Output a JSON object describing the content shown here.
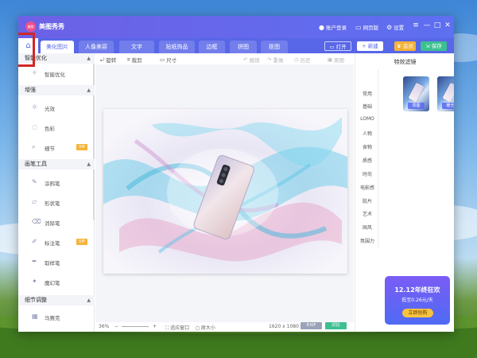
{
  "app": {
    "logo_text": "美图",
    "title": "美图秀秀"
  },
  "titlebar": {
    "account": "账户登录",
    "web_version": "网页版",
    "settings": "设置",
    "menu_symbol": "≡",
    "minimize_symbol": "—",
    "maximize_symbol": "□",
    "close_symbol": "✕"
  },
  "tabs": [
    {
      "label": "美化图片",
      "active": true
    },
    {
      "label": "人像美容",
      "active": false
    },
    {
      "label": "文字",
      "active": false
    },
    {
      "label": "贴纸饰品",
      "active": false
    },
    {
      "label": "边框",
      "active": false
    },
    {
      "label": "拼图",
      "active": false
    },
    {
      "label": "抠图",
      "active": false
    }
  ],
  "actions": {
    "open": "打开",
    "new": "+ 新建",
    "vip": "会员",
    "save": "保存"
  },
  "sidebar": {
    "sections": [
      {
        "title": "智能优化",
        "items": [
          {
            "label": "智能优化",
            "icon": "lightbulb-icon",
            "vip": false
          }
        ]
      },
      {
        "title": "增强",
        "items": [
          {
            "label": "光效",
            "icon": "sun-icon",
            "vip": false
          },
          {
            "label": "色彩",
            "icon": "palette-icon",
            "vip": false
          },
          {
            "label": "细节",
            "icon": "magnifier-icon",
            "vip": true
          }
        ]
      },
      {
        "title": "画笔工具",
        "items": [
          {
            "label": "涂鸦笔",
            "icon": "brush-icon",
            "vip": false
          },
          {
            "label": "形状笔",
            "icon": "shape-pen-icon",
            "vip": false
          },
          {
            "label": "消除笔",
            "icon": "eraser-icon",
            "vip": false
          },
          {
            "label": "标注笔",
            "icon": "marker-icon",
            "vip": true
          },
          {
            "label": "取样笔",
            "icon": "eyedropper-icon",
            "vip": false
          },
          {
            "label": "魔幻笔",
            "icon": "magic-pen-icon",
            "vip": false
          }
        ]
      },
      {
        "title": "细节调整",
        "items": [
          {
            "label": "马赛克",
            "icon": "mosaic-icon",
            "vip": false
          }
        ]
      }
    ],
    "vip_label": "VIP"
  },
  "toolbar": {
    "rotate": "旋转",
    "crop": "裁剪",
    "size": "尺寸",
    "undo": "撤销",
    "redo": "重做",
    "history": "历史",
    "original": "原图"
  },
  "status": {
    "zoom": "36%",
    "fit": "适应窗口",
    "actual_size": "原大小",
    "dimensions": "1620 x 1080",
    "exif": "EXIF",
    "compare": "对比"
  },
  "right_panel": {
    "title": "特效滤镜",
    "categories": [
      "常用",
      "基础",
      "LOMO",
      "人物",
      "食物",
      "质感",
      "时尚",
      "电影感",
      "胶片",
      "艺术",
      "国风",
      "氛围力"
    ],
    "thumbnails": [
      "原图",
      "暖光"
    ],
    "promo": {
      "title": "12.12年终狂欢",
      "subtitle": "低至0.26元/天",
      "button": "立即抢购"
    }
  },
  "colors": {
    "brand": "#5866e8",
    "vip": "#f5b338",
    "save": "#3cc091"
  }
}
